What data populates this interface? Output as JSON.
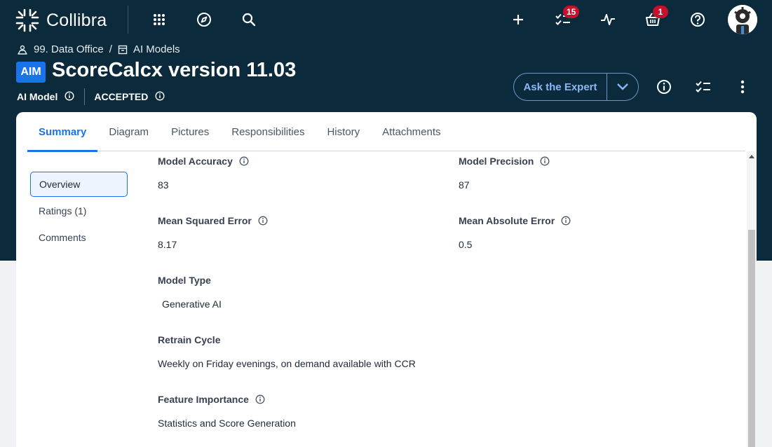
{
  "app": {
    "name": "Collibra"
  },
  "header": {
    "tasks_count": "15",
    "basket_count": "1"
  },
  "breadcrumb": {
    "community": "99. Data Office",
    "separator": "/",
    "domain": "AI Models"
  },
  "asset": {
    "type_badge": "AIM",
    "title": "ScoreCalcx version 11.03",
    "type_name": "AI Model",
    "status": "ACCEPTED"
  },
  "actions": {
    "ask_expert": "Ask the Expert"
  },
  "tabs": [
    "Summary",
    "Diagram",
    "Pictures",
    "Responsibilities",
    "History",
    "Attachments"
  ],
  "sidenav": [
    "Overview",
    "Ratings (1)",
    "Comments"
  ],
  "fields": {
    "model_accuracy": {
      "label": "Model Accuracy",
      "value": "83"
    },
    "model_precision": {
      "label": "Model Precision",
      "value": "87"
    },
    "mse": {
      "label": "Mean Squared Error",
      "value": "8.17"
    },
    "mae": {
      "label": "Mean Absolute Error",
      "value": "0.5"
    },
    "model_type": {
      "label": "Model Type",
      "value": "Generative AI"
    },
    "retrain_cycle": {
      "label": "Retrain Cycle",
      "value": "Weekly on Friday evenings, on demand available with CCR"
    },
    "feature_importance": {
      "label": "Feature Importance",
      "value": "Statistics and Score Generation"
    }
  },
  "colors": {
    "header_bg": "#0b2a3c",
    "accent": "#1a73e8",
    "badge_red": "#c8102e"
  }
}
